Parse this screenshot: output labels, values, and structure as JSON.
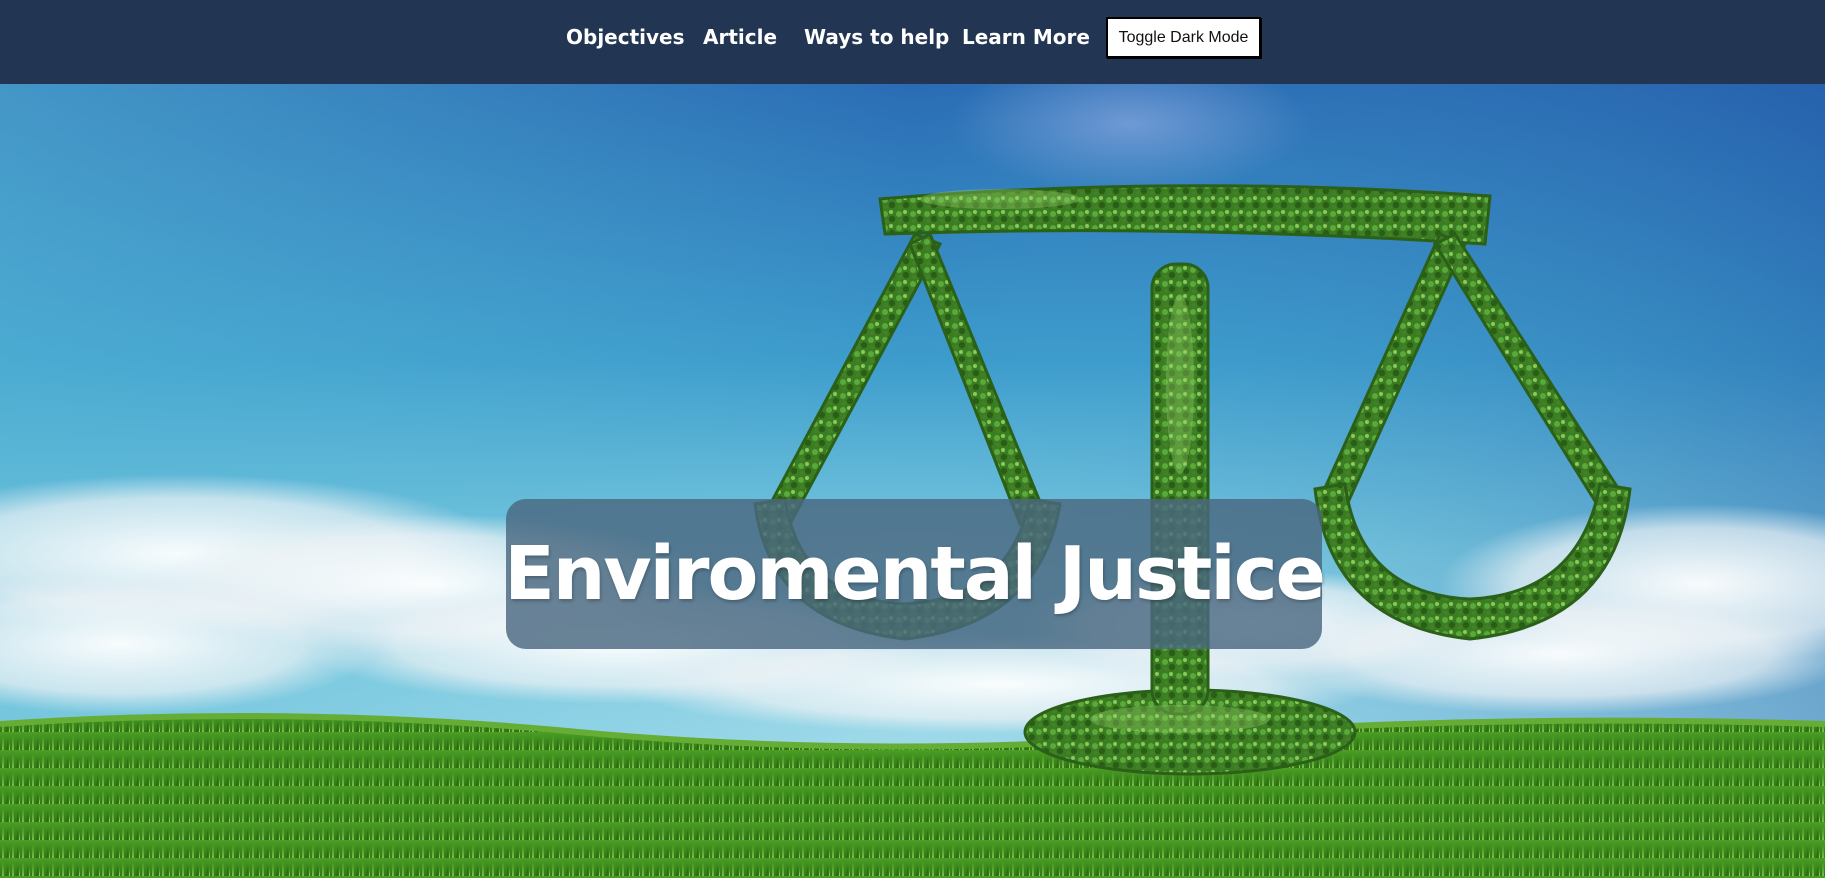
{
  "nav": {
    "links": [
      {
        "label": "Objectives"
      },
      {
        "label": "Article"
      },
      {
        "label": "Ways to help"
      },
      {
        "label": "Learn More"
      }
    ],
    "toggle_label": "Toggle Dark Mode"
  },
  "hero": {
    "title": "Enviromental Justice",
    "image_subject": "leafy-scales-of-justice-on-grass-field"
  },
  "colors": {
    "nav_background": "#223552",
    "title_box": "#4a6880",
    "sky_top": "#2a6cb4",
    "sky_bottom": "#8fd0e8",
    "grass": "#3f8f1e",
    "foliage": "#3a7d22"
  }
}
